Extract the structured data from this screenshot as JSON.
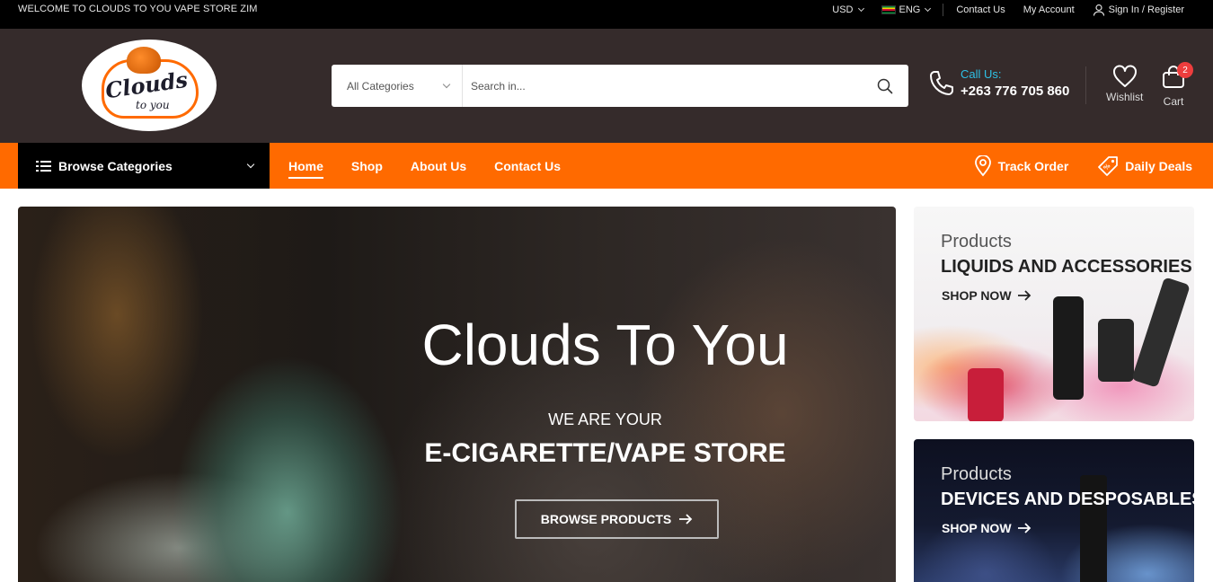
{
  "topbar": {
    "welcome": "WELCOME TO CLOUDS TO YOU VAPE STORE ZIM",
    "currency": "USD",
    "language": "ENG",
    "contact_link": "Contact Us",
    "account_link": "My Account",
    "signin_link": "Sign In / Register"
  },
  "header": {
    "logo_text": "Clouds",
    "logo_sub": "to you",
    "search": {
      "category": "All Categories",
      "placeholder": "Search in..."
    },
    "call": {
      "label": "Call Us:",
      "number": "+263 776 705 860"
    },
    "wishlist_label": "Wishlist",
    "cart_label": "Cart",
    "cart_count": "2"
  },
  "nav": {
    "browse_label": "Browse Categories",
    "items": [
      {
        "label": "Home",
        "active": true
      },
      {
        "label": "Shop"
      },
      {
        "label": "About Us"
      },
      {
        "label": "Contact Us"
      }
    ],
    "track_order": "Track Order",
    "daily_deals": "Daily Deals"
  },
  "hero": {
    "title": "Clouds To You",
    "subtitle": "WE ARE YOUR",
    "headline": "E-CIGARETTE/VAPE STORE",
    "button": "BROWSE PRODUCTS"
  },
  "banners": [
    {
      "kicker": "Products",
      "title": "LIQUIDS AND ACCESSORIES",
      "link": "SHOP NOW"
    },
    {
      "kicker": "Products",
      "title": "DEVICES AND DESPOSABLES",
      "link": "SHOP NOW"
    }
  ],
  "colors": {
    "accent": "#ff6a00",
    "header_bg": "#352b2b",
    "topbar_bg": "#000000",
    "call_label": "#2ec0e6",
    "badge": "#ee3d3d"
  }
}
